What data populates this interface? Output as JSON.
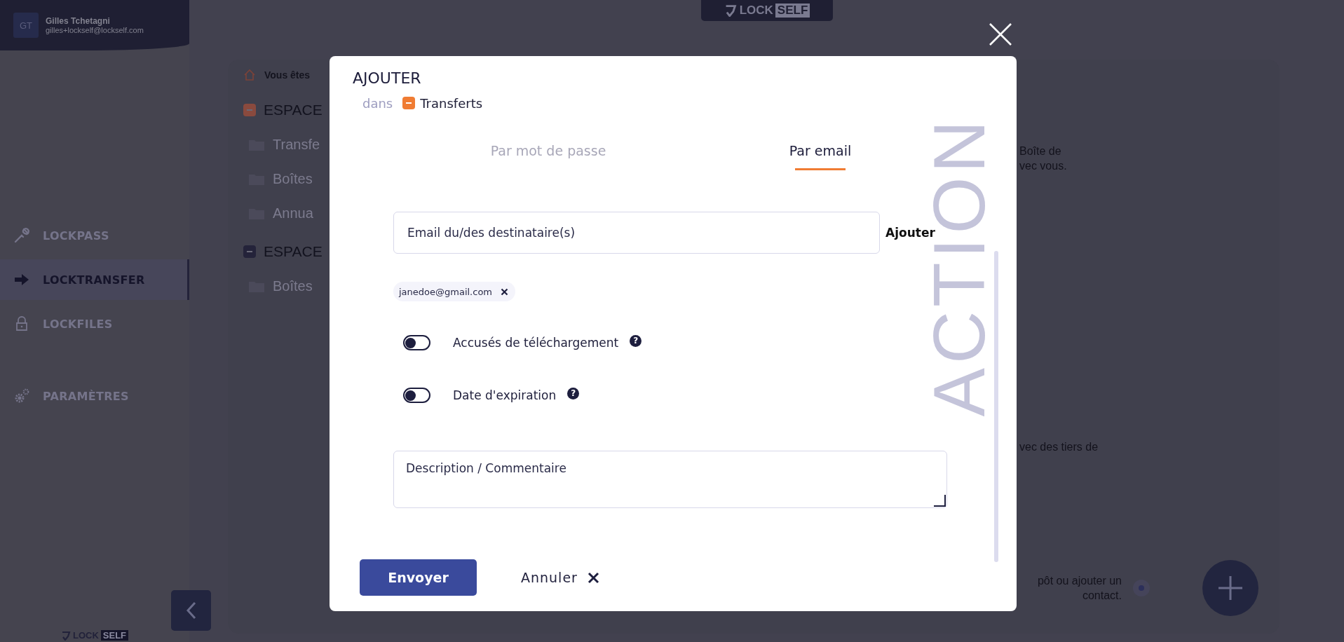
{
  "header_logo": {
    "left": "LOCK",
    "right": "SELF"
  },
  "sidebar": {
    "user": {
      "initials": "GT",
      "name": "Gilles Tchetagni",
      "email": "gilles+lockself@lockself.com"
    },
    "nav": [
      {
        "label": "LOCKPASS",
        "selected": false
      },
      {
        "label": "LOCKTRANSFER",
        "selected": true
      },
      {
        "label": "LOCKFILES",
        "selected": false
      },
      {
        "label": "PARAMÈTRES",
        "selected": false
      }
    ],
    "logo": {
      "left": "LOCK",
      "right": "SELF"
    }
  },
  "breadcrumb": "Vous êtes",
  "tree": [
    {
      "label": "ESPACE",
      "color": "#8a4a3e",
      "children": [
        {
          "label": "Transfe"
        },
        {
          "label": "Boîtes"
        },
        {
          "label": "Annua"
        }
      ]
    },
    {
      "label": "ESPACE",
      "color": "#24233a",
      "children": [
        {
          "label": "Boîtes"
        }
      ]
    }
  ],
  "notes": [
    {
      "lines": [
        "Boîte de",
        "vec vous."
      ]
    },
    {
      "lines": [
        "vec des tiers de"
      ]
    },
    {
      "lines": [
        "pôt ou ajouter un",
        "contact."
      ]
    }
  ],
  "modal": {
    "title": "AJOUTER",
    "location_prefix": "dans",
    "location": "Transferts",
    "watermark": "ACTION",
    "tabs": [
      {
        "label": "Par mot de passe",
        "selected": false
      },
      {
        "label": "Par email",
        "selected": true
      }
    ],
    "recipient_field": {
      "placeholder": "Email du/des destinataire(s)"
    },
    "add_label": "Ajouter",
    "recipients": [
      {
        "email": "janedoe@gmail.com"
      }
    ],
    "options": [
      {
        "label": "Accusés de téléchargement",
        "on": false,
        "hint": "?"
      },
      {
        "label": "Date d'expiration",
        "on": false,
        "hint": "?"
      }
    ],
    "description": {
      "placeholder": "Description / Commentaire"
    },
    "submit": "Envoyer",
    "cancel": "Annuler"
  }
}
